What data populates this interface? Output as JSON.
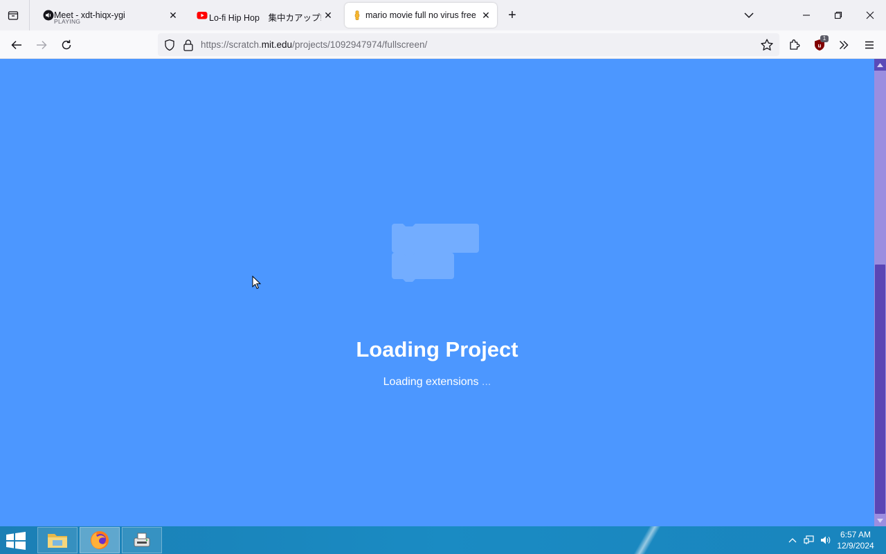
{
  "browser": {
    "tabs": [
      {
        "title": "Meet - xdt-hiqx-ygi",
        "subtitle": "PLAYING",
        "active": false
      },
      {
        "title": "Lo-fi Hip Hop　集中カアップ!",
        "active": false
      },
      {
        "title": "mario movie full no virus free d",
        "active": true
      }
    ],
    "url": {
      "prefix": "https://scratch.",
      "domain": "mit.edu",
      "path": "/projects/1092947974/fullscreen/"
    },
    "extension_badge": "1"
  },
  "page": {
    "title": "Loading Project",
    "message": "Loading extensions",
    "dots": "..."
  },
  "taskbar": {
    "time": "6:57 AM",
    "date": "12/9/2024"
  },
  "colors": {
    "scratch_blue": "#4c97ff",
    "scrollbar_thumb": "#5a46b5"
  }
}
